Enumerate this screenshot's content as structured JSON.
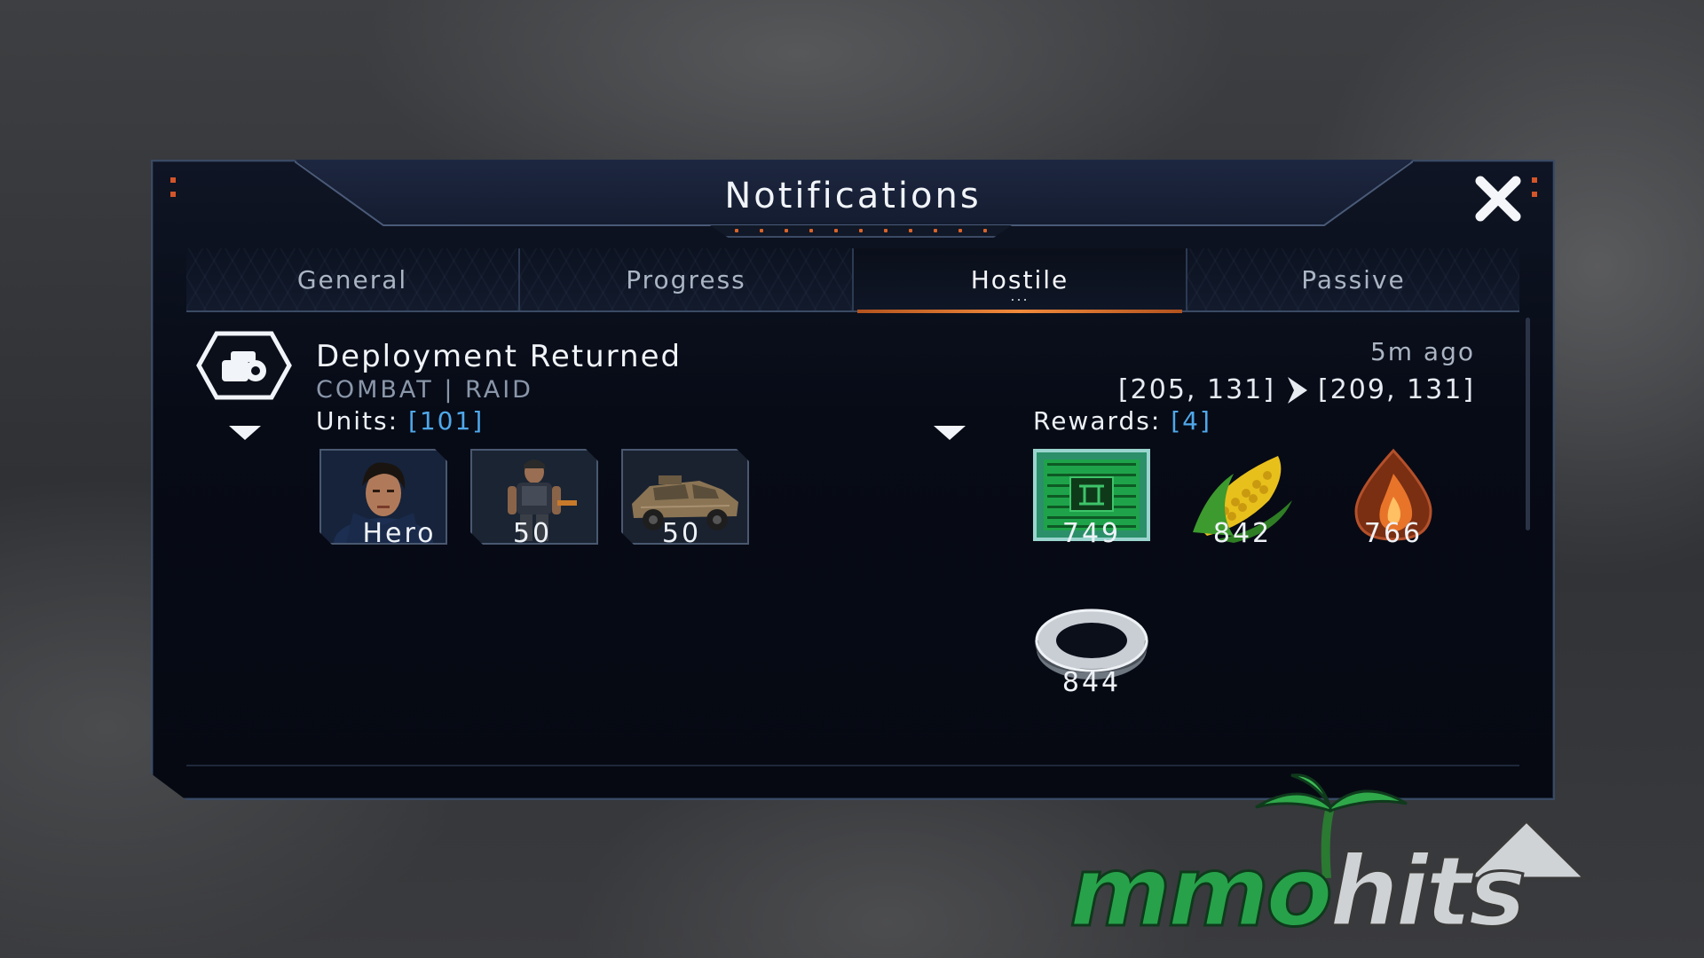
{
  "dialog": {
    "title": "Notifications",
    "close_icon": "close-icon"
  },
  "tabs": [
    {
      "label": "General",
      "active": false
    },
    {
      "label": "Progress",
      "active": false
    },
    {
      "label": "Hostile",
      "active": true,
      "indicator": "..."
    },
    {
      "label": "Passive",
      "active": false
    }
  ],
  "entry": {
    "icon": "deployment-hex-icon",
    "title": "Deployment Returned",
    "subtitle": "COMBAT | RAID",
    "time": "5m ago",
    "from_coords": "[205, 131]",
    "to_coords": "[209, 131]",
    "units": {
      "label": "Units:",
      "count": "[101]",
      "items": [
        {
          "icon": "hero-portrait-icon",
          "value": "Hero"
        },
        {
          "icon": "soldier-unit-icon",
          "value": "50"
        },
        {
          "icon": "armored-vehicle-icon",
          "value": "50"
        }
      ]
    },
    "rewards": {
      "label": "Rewards:",
      "count": "[4]",
      "items": [
        {
          "icon": "microchip-icon",
          "value": "749"
        },
        {
          "icon": "corn-icon",
          "value": "842"
        },
        {
          "icon": "oil-drop-icon",
          "value": "766"
        },
        {
          "icon": "steel-ring-icon",
          "value": "844"
        }
      ]
    }
  },
  "watermark": {
    "part1": "mmo",
    "part2": "hits"
  },
  "colors": {
    "accent": "#4fa8ea",
    "tab_underline": "#f08a3c",
    "panel_bg": "#070b16"
  }
}
